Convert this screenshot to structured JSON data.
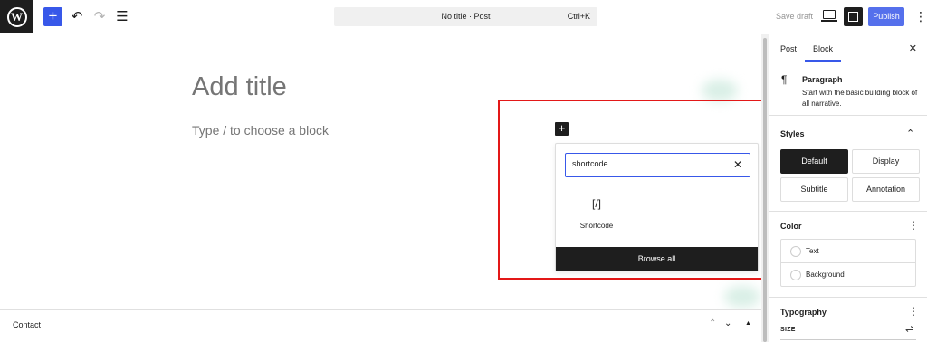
{
  "topbar": {
    "logo_letter": "W",
    "add_block": "+",
    "undo": "↶",
    "redo": "↷",
    "list_view": "☰",
    "command_title": "No title · Post",
    "command_shortcut": "Ctrl+K",
    "save_draft": "Save draft",
    "publish": "Publish",
    "more": "⋮",
    "accent_color": "#3858e9"
  },
  "editor": {
    "title_placeholder": "Add title",
    "block_hint": "Type / to choose a block",
    "inline_add": "+"
  },
  "inserter": {
    "search_value": "shortcode",
    "clear": "✕",
    "results": [
      {
        "icon": "[/]",
        "label": "Shortcode"
      }
    ],
    "browse_all": "Browse all"
  },
  "highlight_color": "#e31818",
  "footer": {
    "label": "Contact",
    "up": "⌃",
    "down": "⌄",
    "collapse": "▲"
  },
  "sidebar": {
    "tabs": [
      "Post",
      "Block"
    ],
    "active_tab": "Block",
    "close": "✕",
    "block": {
      "icon": "¶",
      "name": "Paragraph",
      "description": "Start with the basic building block of all narrative."
    },
    "styles": {
      "title": "Styles",
      "toggle": "⌃",
      "options": [
        "Default",
        "Display",
        "Subtitle",
        "Annotation"
      ],
      "active": "Default"
    },
    "color": {
      "title": "Color",
      "menu": "⋮",
      "items": [
        "Text",
        "Background"
      ]
    },
    "typography": {
      "title": "Typography",
      "menu": "⋮",
      "size_label": "SIZE",
      "size_icon": "⇌"
    }
  }
}
